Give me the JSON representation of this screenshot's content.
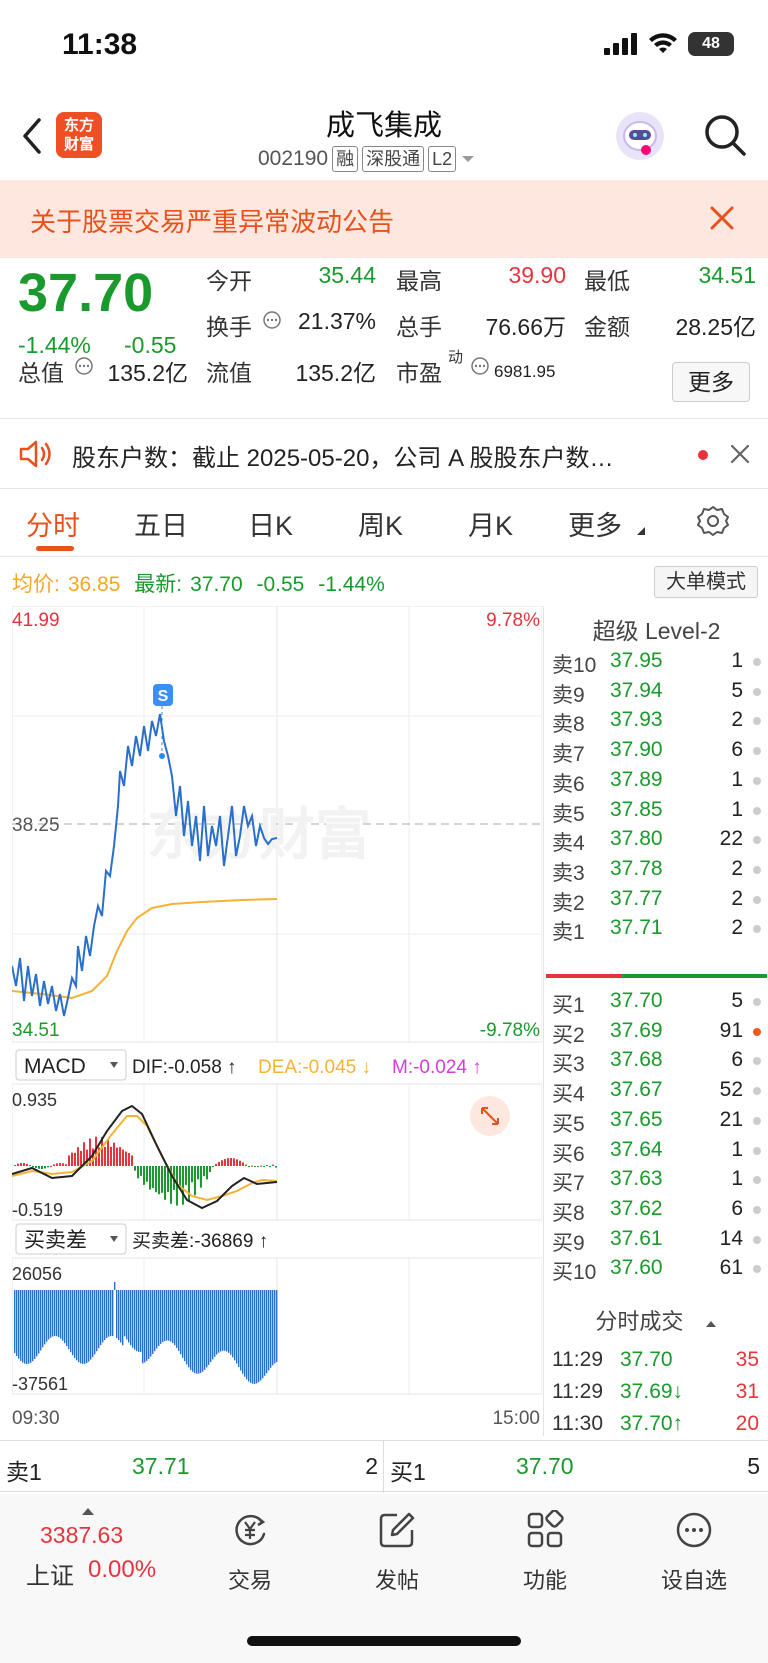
{
  "status": {
    "time": "11:38",
    "battery": "48"
  },
  "header": {
    "logo_top": "东方",
    "logo_bottom": "财富",
    "name": "成飞集成",
    "code": "002190",
    "tags": [
      "融",
      "深股通",
      "L2"
    ]
  },
  "notice": {
    "text": "关于股票交易严重异常波动公告"
  },
  "quote": {
    "price": "37.70",
    "change_pct": "-1.44%",
    "change_amt": "-0.55",
    "open_label": "今开",
    "open": "35.44",
    "high_label": "最高",
    "high": "39.90",
    "low_label": "最低",
    "low": "34.51",
    "turnover_label": "换手",
    "turnover": "21.37%",
    "volume_label": "总手",
    "volume": "76.66万",
    "amount_label": "金额",
    "amount": "28.25亿",
    "mktcap_label": "总值",
    "mktcap": "135.2亿",
    "float_label": "流值",
    "float": "135.2亿",
    "pe_label": "市盈",
    "pe_sup": "动",
    "pe": "6981.95",
    "more_btn": "更多"
  },
  "ticker": {
    "text": "股东户数：截止 2025-05-20，公司 A 股股东户数…"
  },
  "tabs": [
    "分时",
    "五日",
    "日K",
    "周K",
    "月K",
    "更多"
  ],
  "infoline": {
    "avg_label": "均价:",
    "avg": "36.85",
    "last_label": "最新:",
    "last": "37.70",
    "chg": "-0.55",
    "pct": "-1.44%",
    "big_order_btn": "大单模式"
  },
  "chart_labels": {
    "ymax": "41.99",
    "ymid": "38.25",
    "ymin": "34.51",
    "pmax": "9.78%",
    "pmin": "-9.78%",
    "marker": "S",
    "watermark": "东方财富",
    "macd_sel": "MACD",
    "dif": "DIF:-0.058 ↑",
    "dea": "DEA:-0.045 ↓",
    "m": "M:-0.024 ↑",
    "macd_max": "0.935",
    "macd_min": "-0.519",
    "bs_sel": "买卖差",
    "bs_val": "买卖差:-36869 ↑",
    "bs_max": "26056",
    "bs_min": "-37561",
    "t_start": "09:30",
    "t_end": "15:00"
  },
  "orderbook": {
    "title": "超级 Level-2",
    "asks": [
      {
        "label": "卖10",
        "price": "37.95",
        "vol": "1"
      },
      {
        "label": "卖9",
        "price": "37.94",
        "vol": "5"
      },
      {
        "label": "卖8",
        "price": "37.93",
        "vol": "2"
      },
      {
        "label": "卖7",
        "price": "37.90",
        "vol": "6"
      },
      {
        "label": "卖6",
        "price": "37.89",
        "vol": "1"
      },
      {
        "label": "卖5",
        "price": "37.85",
        "vol": "1"
      },
      {
        "label": "卖4",
        "price": "37.80",
        "vol": "22"
      },
      {
        "label": "卖3",
        "price": "37.78",
        "vol": "2"
      },
      {
        "label": "卖2",
        "price": "37.77",
        "vol": "2"
      },
      {
        "label": "卖1",
        "price": "37.71",
        "vol": "2"
      }
    ],
    "bids": [
      {
        "label": "买1",
        "price": "37.70",
        "vol": "5"
      },
      {
        "label": "买2",
        "price": "37.69",
        "vol": "91"
      },
      {
        "label": "买3",
        "price": "37.68",
        "vol": "6"
      },
      {
        "label": "买4",
        "price": "37.67",
        "vol": "52"
      },
      {
        "label": "买5",
        "price": "37.65",
        "vol": "21"
      },
      {
        "label": "买6",
        "price": "37.64",
        "vol": "1"
      },
      {
        "label": "买7",
        "price": "37.63",
        "vol": "1"
      },
      {
        "label": "买8",
        "price": "37.62",
        "vol": "6"
      },
      {
        "label": "买9",
        "price": "37.61",
        "vol": "14"
      },
      {
        "label": "买10",
        "price": "37.60",
        "vol": "61"
      }
    ],
    "trades_title": "分时成交",
    "trades": [
      {
        "time": "11:29",
        "price": "37.70",
        "vol": "35"
      },
      {
        "time": "11:29",
        "price": "37.69↓",
        "vol": "31"
      },
      {
        "time": "11:30",
        "price": "37.70↑",
        "vol": "20"
      }
    ]
  },
  "bidask": {
    "ask_label": "卖1",
    "ask_price": "37.71",
    "ask_vol": "2",
    "bid_label": "买1",
    "bid_price": "37.70",
    "bid_vol": "5"
  },
  "bottom_nav": {
    "index_value": "3387.63",
    "index_name": "上证",
    "index_change": "0.00%",
    "items": [
      "交易",
      "发帖",
      "功能",
      "设自选"
    ]
  },
  "colors": {
    "up": "#e8333c",
    "down": "#1a9a2c",
    "accent": "#e8501c",
    "price_line": "#2a6fc9",
    "avg_line": "#f5b335"
  }
}
